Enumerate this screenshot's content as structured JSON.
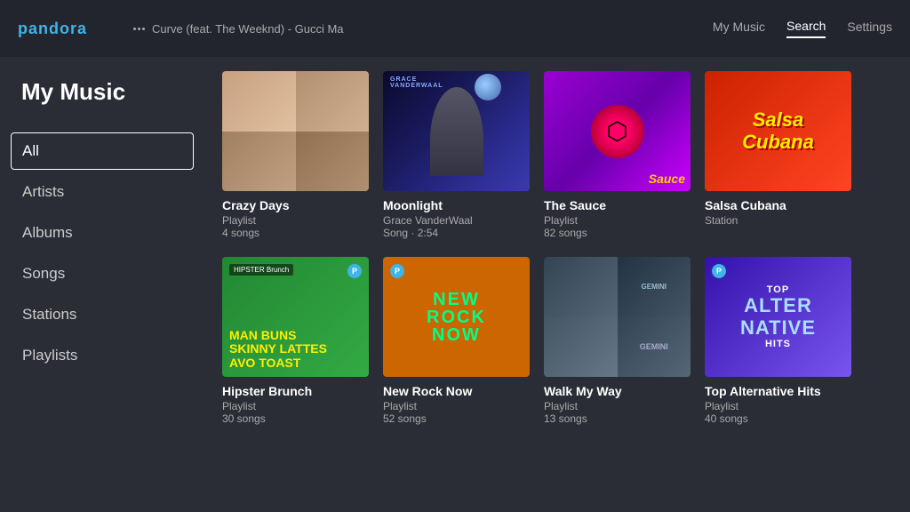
{
  "header": {
    "logo": "pandora",
    "now_playing": "Curve (feat. The Weeknd) - Gucci Ma",
    "nav": {
      "my_music": "My Music",
      "search": "Search",
      "settings": "Settings"
    }
  },
  "sidebar": {
    "title": "My Music",
    "items": [
      {
        "id": "all",
        "label": "All",
        "active": true
      },
      {
        "id": "artists",
        "label": "Artists",
        "active": false
      },
      {
        "id": "albums",
        "label": "Albums",
        "active": false
      },
      {
        "id": "songs",
        "label": "Songs",
        "active": false
      },
      {
        "id": "stations",
        "label": "Stations",
        "active": false
      },
      {
        "id": "playlists",
        "label": "Playlists",
        "active": false
      }
    ]
  },
  "grid": {
    "items": [
      {
        "id": "crazy-days",
        "title": "Crazy Days",
        "type": "Playlist",
        "detail": "4 songs"
      },
      {
        "id": "moonlight",
        "title": "Moonlight",
        "type": "Grace VanderWaal",
        "detail": "Song · 2:54"
      },
      {
        "id": "the-sauce",
        "title": "The Sauce",
        "type": "Playlist",
        "detail": "82 songs"
      },
      {
        "id": "salsa-cubana",
        "title": "Salsa Cubana",
        "type": "Station",
        "detail": ""
      },
      {
        "id": "hipster-brunch",
        "title": "Hipster Brunch",
        "type": "Playlist",
        "detail": "30 songs"
      },
      {
        "id": "new-rock-now",
        "title": "New Rock Now",
        "type": "Playlist",
        "detail": "52 songs"
      },
      {
        "id": "walk-my-way",
        "title": "Walk My Way",
        "type": "Playlist",
        "detail": "13 songs"
      },
      {
        "id": "top-alternative-hits",
        "title": "Top Alternative Hits",
        "type": "Playlist",
        "detail": "40 songs"
      }
    ]
  }
}
